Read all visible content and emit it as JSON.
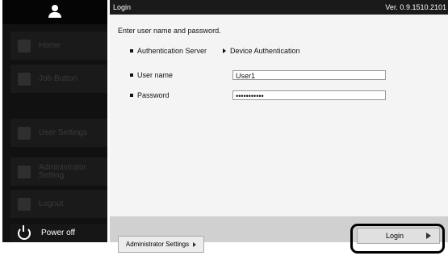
{
  "sidebar": {
    "items": [
      {
        "label": "Home",
        "icon": "home-icon"
      },
      {
        "label": "Job Button",
        "icon": "job-button-icon"
      },
      {
        "label": "User Settings",
        "icon": "user-settings-icon"
      },
      {
        "label": "Administrator Setting",
        "icon": "administrator-setting-icon"
      },
      {
        "label": "Logout",
        "icon": "logout-icon"
      }
    ],
    "power": {
      "label": "Power off",
      "icon": "power-icon"
    }
  },
  "titlebar": {
    "title": "Login",
    "version": "Ver. 0.9.1510.2101"
  },
  "form": {
    "prompt": "Enter user name and password.",
    "auth_server_label": "Authentication Server",
    "device_auth_label": "Device Authentication",
    "username_label": "User name",
    "username_value": "User1",
    "password_label": "Password",
    "password_value": "•••••••••••"
  },
  "footer": {
    "admin_label": "Administrator Settings",
    "login_label": "Login"
  }
}
